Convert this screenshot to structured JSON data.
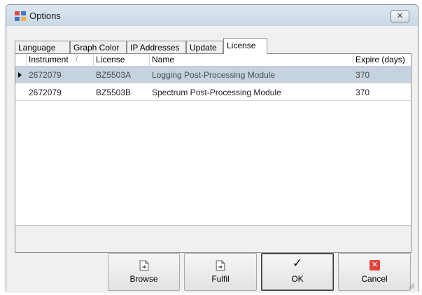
{
  "window": {
    "title": "Options",
    "app_icon": "options-app-icon",
    "close_icon": "close-icon",
    "close_glyph": "✕"
  },
  "tabs": [
    {
      "label": "Language",
      "active": false
    },
    {
      "label": "Graph Color",
      "active": false
    },
    {
      "label": "IP Addresses",
      "active": false
    },
    {
      "label": "Update",
      "active": false
    },
    {
      "label": "License",
      "active": true
    }
  ],
  "grid": {
    "sort_indicator": "/",
    "columns": [
      "Instrument",
      "License",
      "Name",
      "Expire (days)"
    ],
    "rows": [
      {
        "instrument": "2672079",
        "license": "BZ5503A",
        "name": "Logging Post-Processing Module",
        "expire": "370",
        "selected": true
      },
      {
        "instrument": "2672079",
        "license": "BZ5503B",
        "name": "Spectrum Post-Processing Module",
        "expire": "370",
        "selected": false
      }
    ]
  },
  "buttons": {
    "browse": {
      "label": "Browse",
      "icon": "document-icon"
    },
    "fulfil": {
      "label": "Fulfil",
      "icon": "document-icon"
    },
    "ok": {
      "label": "OK",
      "icon": "checkmark-icon",
      "glyph": "✓"
    },
    "cancel": {
      "label": "Cancel",
      "icon": "cancel-icon",
      "glyph": "✕"
    }
  },
  "colors": {
    "selected_row": "#c5d3e0",
    "cancel_red": "#e0443a",
    "title_bar": "#dde7f1"
  }
}
